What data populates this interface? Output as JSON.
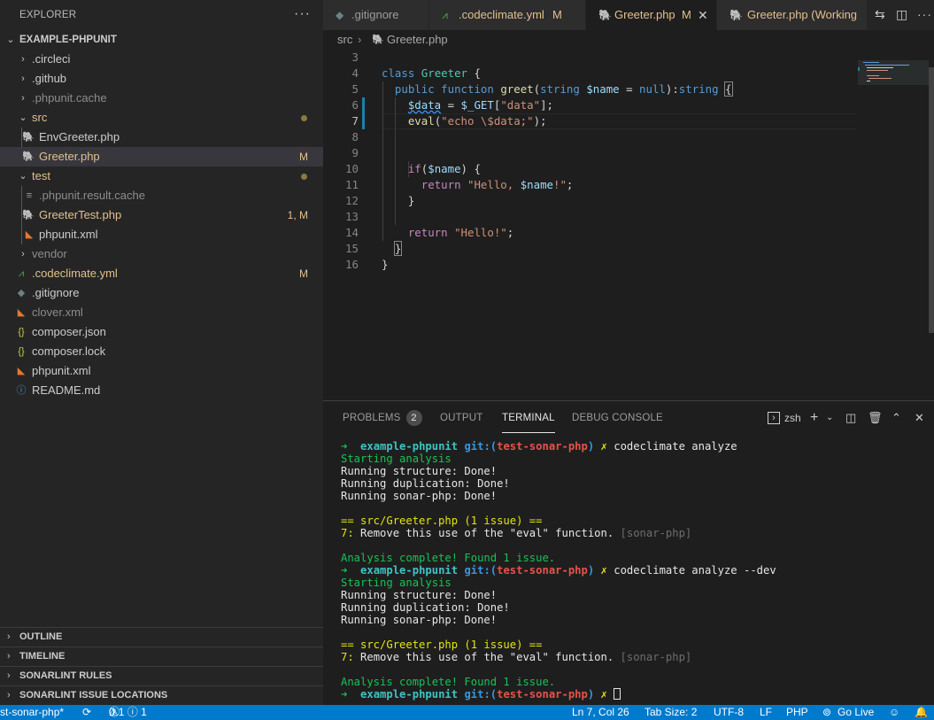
{
  "sidebar": {
    "title": "EXPLORER",
    "more": "···",
    "root": "EXAMPLE-PHPUNIT",
    "items": [
      {
        "label": ".circleci",
        "badge": ""
      },
      {
        "label": ".github",
        "badge": ""
      },
      {
        "label": ".phpunit.cache",
        "badge": ""
      },
      {
        "label": "src",
        "badge": ""
      },
      {
        "label": "EnvGreeter.php",
        "badge": ""
      },
      {
        "label": "Greeter.php",
        "badge": "M"
      },
      {
        "label": "test",
        "badge": ""
      },
      {
        "label": ".phpunit.result.cache",
        "badge": ""
      },
      {
        "label": "GreeterTest.php",
        "badge": "1, M"
      },
      {
        "label": "phpunit.xml",
        "badge": ""
      },
      {
        "label": "vendor",
        "badge": ""
      },
      {
        "label": ".codeclimate.yml",
        "badge": "M"
      },
      {
        "label": ".gitignore",
        "badge": ""
      },
      {
        "label": "clover.xml",
        "badge": ""
      },
      {
        "label": "composer.json",
        "badge": ""
      },
      {
        "label": "composer.lock",
        "badge": ""
      },
      {
        "label": "phpunit.xml",
        "badge": ""
      },
      {
        "label": "README.md",
        "badge": ""
      }
    ],
    "sections": [
      "OUTLINE",
      "TIMELINE",
      "SONARLINT RULES",
      "SONARLINT ISSUE LOCATIONS"
    ]
  },
  "tabs": [
    {
      "label": ".gitignore",
      "mod": ""
    },
    {
      "label": ".codeclimate.yml",
      "mod": "M"
    },
    {
      "label": "Greeter.php",
      "mod": "M"
    },
    {
      "label": "Greeter.php (Working",
      "mod": ""
    }
  ],
  "breadcrumb": {
    "folder": "src",
    "file": "Greeter.php"
  },
  "editor": {
    "line_numbers": [
      "3",
      "4",
      "5",
      "6",
      "7",
      "8",
      "9",
      "10",
      "11",
      "12",
      "13",
      "14",
      "15",
      "16"
    ],
    "current_line": "7"
  },
  "panel": {
    "tabs": [
      "PROBLEMS",
      "OUTPUT",
      "TERMINAL",
      "DEBUG CONSOLE"
    ],
    "problems_count": "2",
    "shell": "zsh"
  },
  "terminal": {
    "arrow": "➜",
    "dir": "example-phpunit",
    "git_open": "git:(",
    "branch": "test-sonar-php",
    "git_close": ")",
    "dirty": "✗",
    "cmd1": "codeclimate analyze",
    "cmd2": "codeclimate analyze --dev",
    "starting": "Starting analysis",
    "structure": "Running structure: Done!",
    "duplication": "Running duplication: Done!",
    "sonar": "Running sonar-php: Done!",
    "file_header": "== src/Greeter.php (1 issue) ==",
    "issue_line": "7:",
    "issue_text": "Remove this use of the \"eval\" function.",
    "issue_engine": "[sonar-php]",
    "complete": "Analysis complete! Found 1 issue."
  },
  "statusbar": {
    "branch": "st-sonar-php*",
    "errors": "0",
    "warnings": "1",
    "infos": "1",
    "position": "Ln 7, Col 26",
    "tab_size": "Tab Size: 2",
    "encoding": "UTF-8",
    "eol": "LF",
    "language": "PHP",
    "go_live": "Go Live"
  },
  "colors": {
    "accent": "#007acc",
    "modified": "#e2c08d",
    "php_icon": "#a074c4",
    "terminal_green": "#19c157"
  }
}
